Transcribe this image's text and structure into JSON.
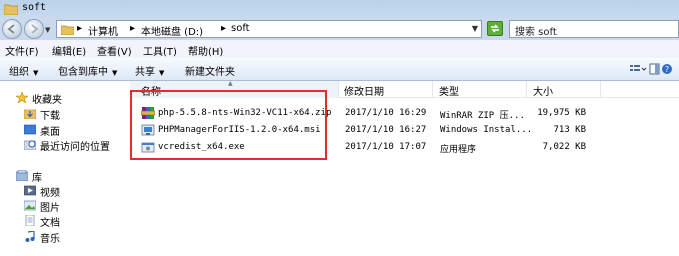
{
  "window": {
    "title": "soft"
  },
  "address": {
    "crumbs": [
      "计算机",
      "本地磁盘 (D:)",
      "soft"
    ],
    "separator": "▸"
  },
  "search": {
    "placeholder": "搜索 soft"
  },
  "menu": [
    "文件(F)",
    "编辑(E)",
    "查看(V)",
    "工具(T)",
    "帮助(H)"
  ],
  "toolbar": {
    "organize": "组织",
    "include": "包含到库中",
    "share": "共享",
    "new_folder": "新建文件夹"
  },
  "nav": {
    "favorites": "收藏夹",
    "downloads": "下载",
    "desktop": "桌面",
    "recent": "最近访问的位置",
    "libraries": "库",
    "videos": "视频",
    "pictures": "图片",
    "documents": "文档",
    "music": "音乐"
  },
  "columns": {
    "name": "名称",
    "date": "修改日期",
    "type": "类型",
    "size": "大小"
  },
  "files": [
    {
      "name": "php-5.5.8-nts-Win32-VC11-x64.zip",
      "date": "2017/1/10 16:29",
      "type": "WinRAR ZIP 压...",
      "size": "19,975 KB",
      "icon": "zip-icon"
    },
    {
      "name": "PHPManagerForIIS-1.2.0-x64.msi",
      "date": "2017/1/10 16:27",
      "type": "Windows Instal...",
      "size": "713 KB",
      "icon": "msi-icon"
    },
    {
      "name": "vcredist_x64.exe",
      "date": "2017/1/10 17:07",
      "type": "应用程序",
      "size": "7,022 KB",
      "icon": "exe-icon"
    }
  ],
  "colors": {
    "highlight": "#e52b2b",
    "accent": "#cad9ec"
  }
}
